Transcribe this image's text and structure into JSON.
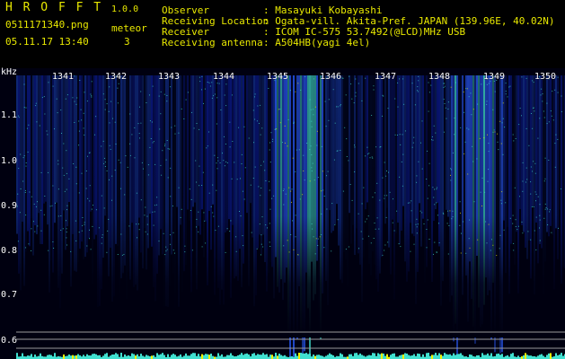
{
  "app": {
    "title": "H R O F F T",
    "version": "1.0.0",
    "filename": "0511171340.png",
    "datetime": "05.11.17 13:40",
    "meteor_label": "meteor",
    "meteor_count": "3"
  },
  "info": {
    "rows": [
      {
        "label": "Observer",
        "value": ": Masayuki Kobayashi"
      },
      {
        "label": "Receiving Location",
        "value": ": Ogata-vill. Akita-Pref. JAPAN (139.96E, 40.02N)"
      },
      {
        "label": "Receiver",
        "value": ": ICOM IC-575 53.7492(@LCD)MHz USB"
      },
      {
        "label": "Receiving antenna",
        "value": ": A504HB(yagi 4el)"
      }
    ]
  },
  "spectrogram": {
    "y_unit": "kHz",
    "y_ticks": [
      "1.1",
      "1.0",
      "0.9",
      "0.8",
      "0.7",
      "0.6"
    ],
    "minute_labels": [
      "1341",
      "1342",
      "1343",
      "1344",
      "1345",
      "1346",
      "1347",
      "1348",
      "1349",
      "1350"
    ],
    "colors": {
      "background": "#000010",
      "low": "#0a1a8a",
      "mid": "#2a5cff",
      "high": "#40e0d0",
      "peak": "#f0f000"
    }
  }
}
